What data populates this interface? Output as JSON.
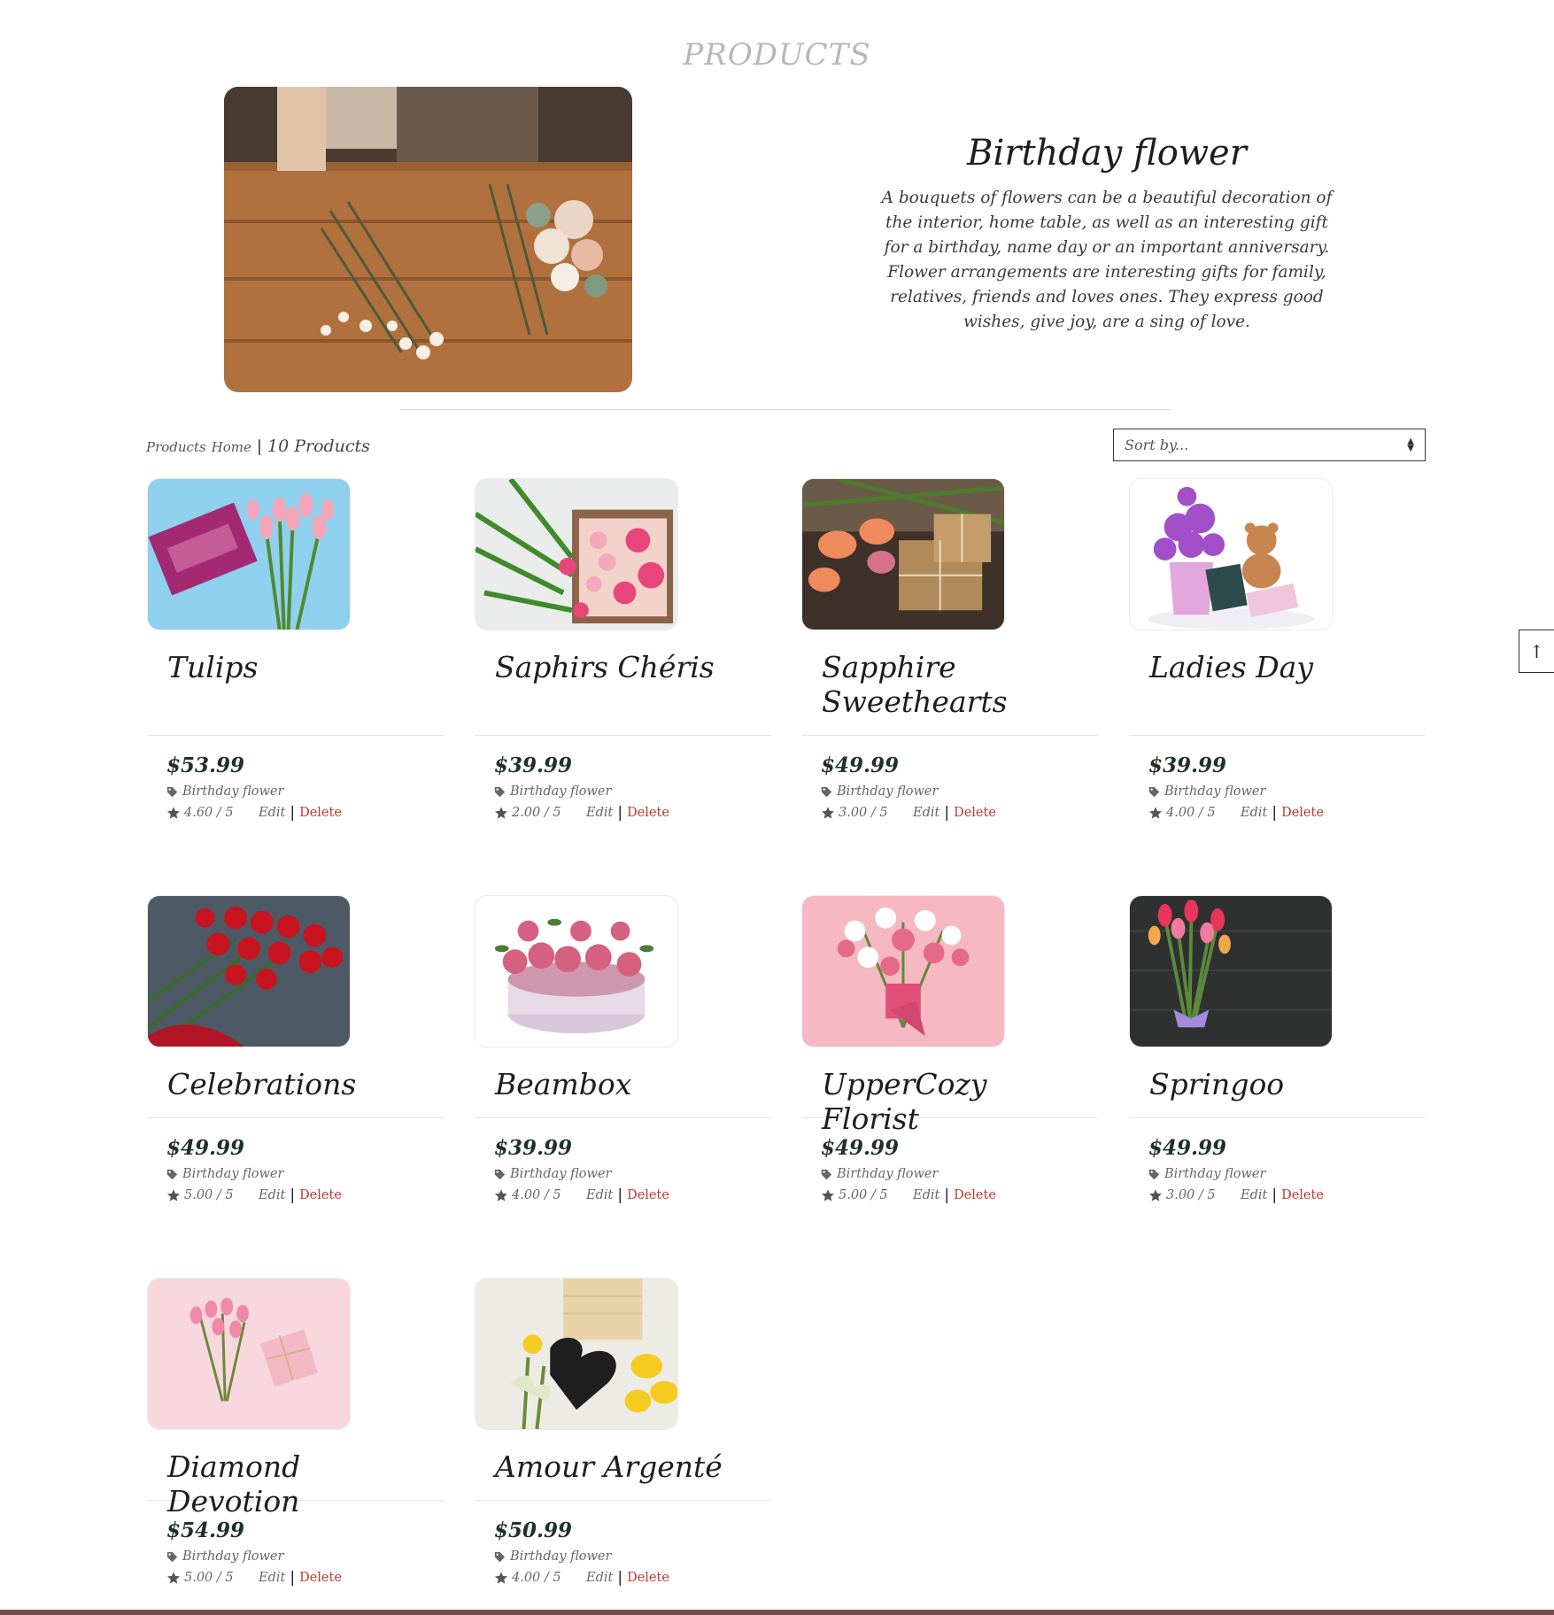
{
  "page": {
    "title": "PRODUCTS"
  },
  "hero": {
    "heading": "Birthday flower",
    "description": "A bouquets of flowers can be a beautiful decoration of the interior, home table, as well as an interesting gift for a birthday, name day or an important anniversary. Flower arrangements are interesting gifts for family, relatives, friends and loves ones. They express good wishes, give joy, are a sing of love."
  },
  "breadcrumb": {
    "products": "Products",
    "home": "Home",
    "separator": "|",
    "count": "10 Products"
  },
  "sort": {
    "label": "Sort by...",
    "icon": "sort-caret-icon"
  },
  "scroll_top": {
    "icon": "arrow-up-icon"
  },
  "products": [
    {
      "name": "Tulips",
      "price": "$53.99",
      "category": "Birthday flower",
      "rating": "4.60 / 5",
      "edit": "Edit",
      "sep": "|",
      "delete": "Delete"
    },
    {
      "name": "Saphirs Chéris",
      "price": "$39.99",
      "category": "Birthday flower",
      "rating": "2.00 / 5",
      "edit": "Edit",
      "sep": "|",
      "delete": "Delete"
    },
    {
      "name": "Sapphire Sweethearts",
      "price": "$49.99",
      "category": "Birthday flower",
      "rating": "3.00 / 5",
      "edit": "Edit",
      "sep": "|",
      "delete": "Delete"
    },
    {
      "name": "Ladies Day",
      "price": "$39.99",
      "category": "Birthday flower",
      "rating": "4.00 / 5",
      "edit": "Edit",
      "sep": "|",
      "delete": "Delete"
    },
    {
      "name": "Celebrations",
      "price": "$49.99",
      "category": "Birthday flower",
      "rating": "5.00 / 5",
      "edit": "Edit",
      "sep": "|",
      "delete": "Delete"
    },
    {
      "name": "Beambox",
      "price": "$39.99",
      "category": "Birthday flower",
      "rating": "4.00 / 5",
      "edit": "Edit",
      "sep": "|",
      "delete": "Delete"
    },
    {
      "name": "UpperCozy Florist",
      "price": "$49.99",
      "category": "Birthday flower",
      "rating": "5.00 / 5",
      "edit": "Edit",
      "sep": "|",
      "delete": "Delete"
    },
    {
      "name": "Springoo",
      "price": "$49.99",
      "category": "Birthday flower",
      "rating": "3.00 / 5",
      "edit": "Edit",
      "sep": "|",
      "delete": "Delete"
    },
    {
      "name": "Diamond Devotion",
      "price": "$54.99",
      "category": "Birthday flower",
      "rating": "5.00 / 5",
      "edit": "Edit",
      "sep": "|",
      "delete": "Delete"
    },
    {
      "name": "Amour Argenté",
      "price": "$50.99",
      "category": "Birthday flower",
      "rating": "4.00 / 5",
      "edit": "Edit",
      "sep": "|",
      "delete": "Delete"
    }
  ],
  "colors": {
    "accent_delete": "#c0392b",
    "price": "#1f3226",
    "footer": "#7a4b4b"
  }
}
